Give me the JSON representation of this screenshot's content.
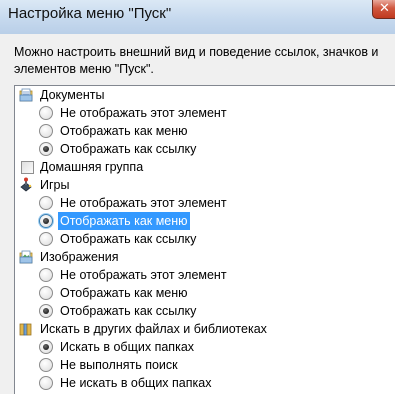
{
  "window": {
    "title": "Настройка меню \"Пуск\"",
    "close_glyph": "✕"
  },
  "description": "Можно настроить внешний вид и поведение ссылок, значков и элементов меню \"Пуск\".",
  "items": {
    "documents": {
      "icon": "documents-folder-icon",
      "label": "Документы",
      "options": [
        "Не отображать этот элемент",
        "Отображать как меню",
        "Отображать как ссылку"
      ],
      "selected": 2
    },
    "homegroup": {
      "label": "Домашняя группа",
      "checked": false
    },
    "games": {
      "icon": "games-joystick-icon",
      "label": "Игры",
      "options": [
        "Не отображать этот элемент",
        "Отображать как меню",
        "Отображать как ссылку"
      ],
      "selected": 1
    },
    "pictures": {
      "icon": "pictures-folder-icon",
      "label": "Изображения",
      "options": [
        "Не отображать этот элемент",
        "Отображать как меню",
        "Отображать как ссылку"
      ],
      "selected": 2
    },
    "search": {
      "icon": "search-folder-icon",
      "label": "Искать в других файлах и библиотеках",
      "options": [
        "Искать в общих папках",
        "Не выполнять поиск",
        "Не искать в общих папках"
      ],
      "selected": 0
    }
  },
  "colors": {
    "selection_bg": "#3399ff",
    "titlebar": "#c6d9ee",
    "close_button": "#c0391f"
  }
}
